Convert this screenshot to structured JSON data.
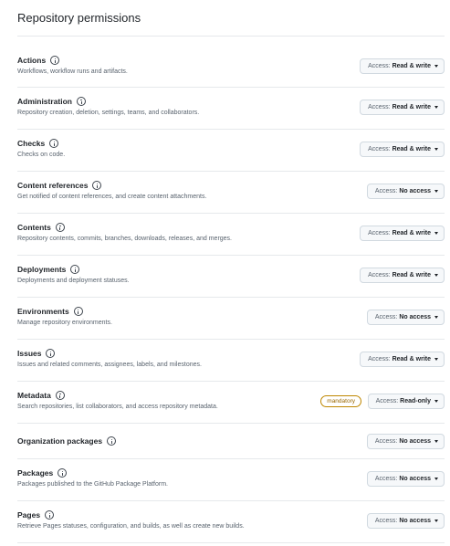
{
  "title": "Repository permissions",
  "access_prefix": "Access:",
  "permissions": [
    {
      "name": "Actions",
      "description": "Workflows, workflow runs and artifacts.",
      "access": "Read & write"
    },
    {
      "name": "Administration",
      "description": "Repository creation, deletion, settings, teams, and collaborators.",
      "access": "Read & write"
    },
    {
      "name": "Checks",
      "description": "Checks on code.",
      "access": "Read & write"
    },
    {
      "name": "Content references",
      "description": "Get notified of content references, and create content attachments.",
      "access": "No access"
    },
    {
      "name": "Contents",
      "description": "Repository contents, commits, branches, downloads, releases, and merges.",
      "access": "Read & write"
    },
    {
      "name": "Deployments",
      "description": "Deployments and deployment statuses.",
      "access": "Read & write"
    },
    {
      "name": "Environments",
      "description": "Manage repository environments.",
      "access": "No access"
    },
    {
      "name": "Issues",
      "description": "Issues and related comments, assignees, labels, and milestones.",
      "access": "Read & write"
    },
    {
      "name": "Metadata",
      "description": "Search repositories, list collaborators, and access repository metadata.",
      "access": "Read-only",
      "badge": "mandatory"
    },
    {
      "name": "Organization packages",
      "description": "",
      "access": "No access"
    },
    {
      "name": "Packages",
      "description": "Packages published to the GitHub Package Platform.",
      "access": "No access"
    },
    {
      "name": "Pages",
      "description": "Retrieve Pages statuses, configuration, and builds, as well as create new builds.",
      "access": "No access"
    }
  ]
}
